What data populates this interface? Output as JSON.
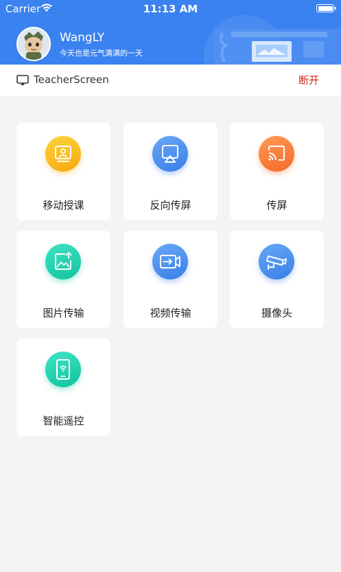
{
  "status_bar": {
    "carrier": "Carrier",
    "time": "11:13 AM"
  },
  "profile": {
    "username": "WangLY",
    "motto": "今天也是元气满满的一天"
  },
  "connection": {
    "device_name": "TeacherScreen",
    "disconnect_label": "断开"
  },
  "features": [
    {
      "label": "移动授课",
      "icon": "mobile-teaching-icon",
      "color": "#f5b317"
    },
    {
      "label": "反向传屏",
      "icon": "reverse-cast-icon",
      "color": "#4a8ff0"
    },
    {
      "label": "传屏",
      "icon": "cast-screen-icon",
      "color": "#f8763a"
    },
    {
      "label": "图片传输",
      "icon": "image-transfer-icon",
      "color": "#1fcfa9"
    },
    {
      "label": "视频传输",
      "icon": "video-transfer-icon",
      "color": "#4a8ff0"
    },
    {
      "label": "摄像头",
      "icon": "camera-icon",
      "color": "#4a8ff0"
    },
    {
      "label": "智能遥控",
      "icon": "smart-remote-icon",
      "color": "#1fcfa9"
    }
  ],
  "colors": {
    "header_bg": "#3a82f0",
    "page_bg": "#f4f4f4",
    "disconnect": "#d0271d"
  }
}
